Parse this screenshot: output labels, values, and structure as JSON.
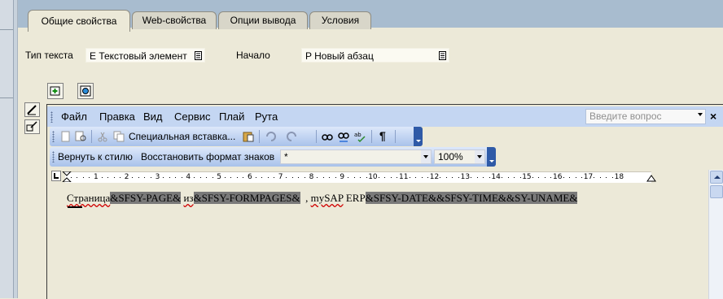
{
  "tabs": [
    {
      "label": "Общие свойства",
      "active": true
    },
    {
      "label": "Web-свойства",
      "active": false
    },
    {
      "label": "Опции вывода",
      "active": false
    },
    {
      "label": "Условия",
      "active": false
    }
  ],
  "fields": {
    "text_type_label": "Тип текста",
    "text_type_value": "E Текстовый элемент",
    "start_label": "Начало",
    "start_value": "P Новый абзац"
  },
  "editor": {
    "menu": [
      "Файл",
      "Правка",
      "Вид",
      "Сервис",
      "Плай",
      "Рута"
    ],
    "ask_placeholder": "Введите вопрос",
    "close": "×",
    "paste_special": "Специальная вставка...",
    "pilcrow": "¶",
    "revert_style": "Вернуть к стилю",
    "restore_format": "Восстановить формат знаков",
    "style_value": "*",
    "zoom_value": "100%",
    "ruler_numbers": [
      "1",
      "2",
      "3",
      "4",
      "5",
      "6",
      "7",
      "8",
      "9",
      "10",
      "11",
      "12",
      "13",
      "14",
      "15",
      "16",
      "17",
      "18"
    ],
    "doc_segments": [
      {
        "text": "Страница",
        "field": false,
        "squiggle": true
      },
      {
        "text": "&SFSY-PAGE&",
        "field": true,
        "squiggle": false
      },
      {
        "text": " ",
        "field": false,
        "squiggle": false
      },
      {
        "text": "из",
        "field": false,
        "squiggle": true
      },
      {
        "text": "&SFSY-FORMPAGES&",
        "field": true,
        "squiggle": false
      },
      {
        "text": "  , ",
        "field": false,
        "squiggle": false
      },
      {
        "text": "mySAP",
        "field": false,
        "squiggle": true
      },
      {
        "text": " ERP",
        "field": false,
        "squiggle": false
      },
      {
        "text": "&SFSY-DATE&&SFSY-TIME&&SY-UNAME&",
        "field": true,
        "squiggle": false
      }
    ]
  },
  "colors": {
    "tab_strip": "#a8bccf",
    "menubar": "#c4d6f2",
    "toolbar_end": "#2f5aa7",
    "field_highlight": "#7a7a7a",
    "spell_squiggle": "#d00000"
  }
}
